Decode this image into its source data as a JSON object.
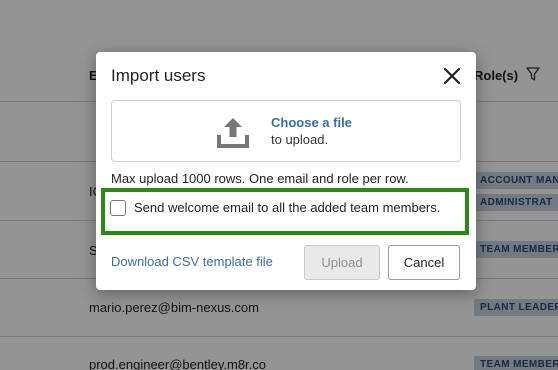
{
  "background": {
    "column_headers": {
      "email": "E",
      "roles": "Role(s)"
    },
    "rows": [
      {
        "email": "IC",
        "tags": [
          "ACCOUNT MAN",
          "ADMINISTRAT"
        ]
      },
      {
        "email": "S",
        "tags": [
          "TEAM MEMBER"
        ]
      },
      {
        "email": "mario.perez@bim-nexus.com",
        "tags": [
          "PLANT LEADER"
        ]
      },
      {
        "email": "prod.engineer@bentley.m8r.co",
        "tags": [
          "TEAM MEMBER"
        ]
      }
    ]
  },
  "modal": {
    "title": "Import users",
    "close_icon": "close-icon",
    "dropzone": {
      "icon": "upload-icon",
      "link": "Choose a file",
      "sub": "to upload."
    },
    "hint": "Max upload 1000 rows. One email and role per row.",
    "checkbox": {
      "label": "Send welcome email to all the added team members.",
      "checked": false
    },
    "csv_link": "Download CSV template file",
    "upload_label": "Upload",
    "cancel_label": "Cancel"
  },
  "colors": {
    "overlay": "#6b6b6b",
    "link": "#3a6ea5",
    "highlight": "#2a8b14",
    "tag_bg": "#c7d3e3"
  }
}
